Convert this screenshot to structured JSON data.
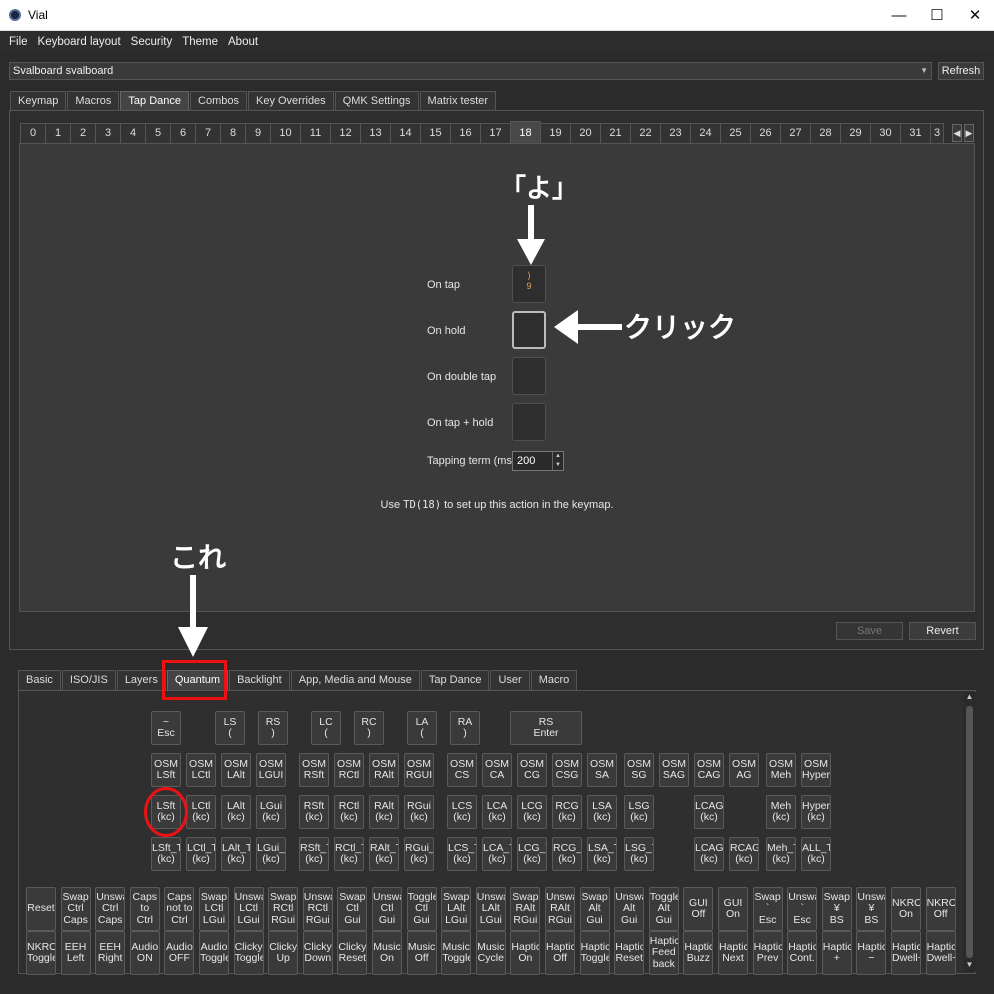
{
  "window": {
    "title": "Vial"
  },
  "menu": [
    "File",
    "Keyboard layout",
    "Security",
    "Theme",
    "About"
  ],
  "device": {
    "selected": "Svalboard svalboard",
    "refresh_label": "Refresh"
  },
  "main_tabs": [
    "Keymap",
    "Macros",
    "Tap Dance",
    "Combos",
    "Key Overrides",
    "QMK Settings",
    "Matrix tester"
  ],
  "td_tabs": [
    "0",
    "1",
    "2",
    "3",
    "4",
    "5",
    "6",
    "7",
    "8",
    "9",
    "10",
    "11",
    "12",
    "13",
    "14",
    "15",
    "16",
    "17",
    "18",
    "19",
    "20",
    "21",
    "22",
    "23",
    "24",
    "25",
    "26",
    "27",
    "28",
    "29",
    "30",
    "31",
    "3"
  ],
  "td_active": "18",
  "tapdance": {
    "on_tap_label": "On tap",
    "on_tap_value_top": ")",
    "on_tap_value_bottom": "9",
    "on_hold_label": "On hold",
    "on_double_tap_label": "On double tap",
    "on_tap_hold_label": "On tap + hold",
    "tapping_term_label": "Tapping term (ms)",
    "tapping_term_value": "200",
    "note_pre": "Use ",
    "note_code": "TD(18)",
    "note_post": " to set up this action in the keymap.",
    "save_label": "Save",
    "revert_label": "Revert"
  },
  "annotations": {
    "yo": "「よ」",
    "click": "クリック",
    "kore": "これ"
  },
  "lower_tabs": [
    "Basic",
    "ISO/JIS",
    "Layers",
    "Quantum",
    "Backlight",
    "App, Media and Mouse",
    "Tap Dance",
    "User",
    "Macro"
  ],
  "keys": {
    "row1": [
      {
        "label": "~\nEsc",
        "wide": false
      },
      {
        "label": "LS\n(",
        "wide": false
      },
      {
        "label": "RS\n)",
        "wide": false
      },
      {
        "label": "LC\n(",
        "wide": false
      },
      {
        "label": "RC\n)",
        "wide": false
      },
      {
        "label": "LA\n(",
        "wide": false
      },
      {
        "label": "RA\n)",
        "wide": false
      },
      {
        "label": "RS\nEnter",
        "wide": true
      }
    ],
    "row2": [
      "OSM\nLSft",
      "OSM\nLCtl",
      "OSM\nLAlt",
      "OSM\nLGUI",
      "OSM\nRSft",
      "OSM\nRCtl",
      "OSM\nRAlt",
      "OSM\nRGUI",
      "OSM\nCS",
      "OSM\nCA",
      "OSM\nCG",
      "OSM\nCSG",
      "OSM\nSA",
      "OSM\nSG",
      "OSM\nSAG",
      "OSM\nCAG",
      "OSM\nAG",
      "OSM\nMeh",
      "OSM\nHyper"
    ],
    "row3": [
      "LSft\n(kc)",
      "LCtl\n(kc)",
      "LAlt\n(kc)",
      "LGui\n(kc)",
      "RSft\n(kc)",
      "RCtl\n(kc)",
      "RAlt\n(kc)",
      "RGui\n(kc)",
      "LCS\n(kc)",
      "LCA\n(kc)",
      "LCG\n(kc)",
      "RCG\n(kc)",
      "LSA\n(kc)",
      "LSG\n(kc)",
      "LCAG\n(kc)",
      "Meh\n(kc)",
      "Hyper\n(kc)"
    ],
    "row4": [
      "LSft_T\n(kc)",
      "LCtl_T\n(kc)",
      "LAlt_T\n(kc)",
      "LGui_T\n(kc)",
      "RSft_T\n(kc)",
      "RCtl_T\n(kc)",
      "RAlt_T\n(kc)",
      "RGui_T\n(kc)",
      "LCS_T\n(kc)",
      "LCA_T\n(kc)",
      "LCG_T\n(kc)",
      "RCG_T\n(kc)",
      "LSA_T\n(kc)",
      "LSG_T\n(kc)",
      "LCAG_T\n(kc)",
      "RCAG_T\n(kc)",
      "Meh_T\n(kc)",
      "ALL_T\n(kc)"
    ],
    "row5": [
      "Reset",
      "Swap\nCtrl\nCaps",
      "Unswap\nCtrl\nCaps",
      "Caps\nto\nCtrl",
      "Caps\nnot to\nCtrl",
      "Swap\nLCtl\nLGui",
      "Unswap\nLCtl\nLGui",
      "Swap\nRCtl\nRGui",
      "Unswap\nRCtl\nRGui",
      "Swap\nCtl\nGui",
      "Unswap\nCtl\nGui",
      "Toggle\nCtl\nGui",
      "Swap\nLAlt\nLGui",
      "Unswap\nLAlt\nLGui",
      "Swap\nRAlt\nRGui",
      "Unswap\nRAlt\nRGui",
      "Swap\nAlt\nGui",
      "Unswap\nAlt\nGui",
      "Toggle\nAlt\nGui",
      "GUI\nOff",
      "GUI\nOn",
      "Swap\n`\nEsc",
      "Unswap\n`\nEsc",
      "Swap\n¥\nBS",
      "Unswap\n¥\nBS",
      "NKRO\nOn",
      "NKRO\nOff"
    ],
    "row6": [
      "NKRO\nToggle",
      "EEH\nLeft",
      "EEH\nRight",
      "Audio\nON",
      "Audio\nOFF",
      "Audio\nToggle",
      "Clicky\nToggle",
      "Clicky\nUp",
      "Clicky\nDown",
      "Clicky\nReset",
      "Music\nOn",
      "Music\nOff",
      "Music\nToggle",
      "Music\nCycle",
      "Haptic\nOn",
      "Haptic\nOff",
      "Haptic\nToggle",
      "Haptic\nReset",
      "Haptic\nFeed\nback",
      "Haptic\nBuzz",
      "Haptic\nNext",
      "Haptic\nPrev",
      "Haptic\nCont.",
      "Haptic\n+",
      "Haptic\n−",
      "Haptic\nDwell+",
      "Haptic\nDwell−"
    ]
  }
}
